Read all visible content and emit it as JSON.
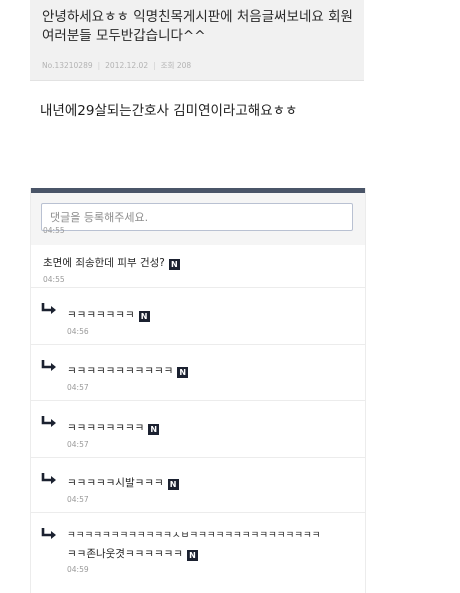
{
  "post": {
    "title": "안녕하세요ㅎㅎ 익명친목게시판에 처음글써보네요 회원여러분들 모두반갑습니다^^",
    "number": "No.13210289",
    "date": "2012.12.02",
    "views": "조회 208",
    "body": "내년에29살되는간호사 김미연이라고해요ㅎㅎ"
  },
  "comment_form": {
    "placeholder": "댓글을 등록해주세요."
  },
  "cut_time": "04:55",
  "badge_label": "N",
  "comments": [
    {
      "text": "초면에 죄송한데 피부 건성?",
      "time": "04:55",
      "reply": false
    },
    {
      "text": "ㅋㅋㅋㅋㅋㅋㅋ",
      "time": "04:56",
      "reply": true
    },
    {
      "text": "ㅋㅋㅋㅋㅋㅋㅋㅋㅋㅋㅋ",
      "time": "04:57",
      "reply": true
    },
    {
      "text": "ㅋㅋㅋㅋㅋㅋㅋㅋ",
      "time": "04:57",
      "reply": true
    },
    {
      "text": "ㅋㅋㅋㅋㅋ시발ㅋㅋㅋ",
      "time": "04:57",
      "reply": true
    },
    {
      "text": "ㅋㅋㅋㅋㅋㅋㅋㅋㅋㅋㅋㅋㅅㅂㅋㅋㅋㅋㅋㅋㅋㅋㅋㅋㅋㅋㅋㅋㅋ",
      "text2": "ㅋㅋ존나웃겻ㅋㅋㅋㅋㅋㅋ",
      "time": "04:59",
      "reply": true
    }
  ]
}
